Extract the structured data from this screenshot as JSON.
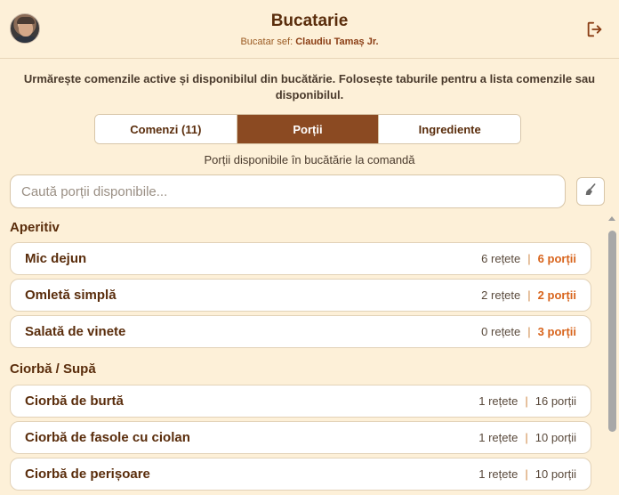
{
  "header": {
    "title": "Bucatarie",
    "chef_prefix": "Bucatar sef:",
    "chef_name": "Claudiu Tamaș Jr.",
    "avatar_icon": "user-avatar",
    "logout_icon": "logout-icon"
  },
  "description": "Urmărește comenzile active și disponibilul din bucătărie. Folosește taburile pentru a lista comenzile sau disponibilul.",
  "tabs": [
    {
      "label": "Comenzi (11)",
      "active": false
    },
    {
      "label": "Porții",
      "active": true
    },
    {
      "label": "Ingrediente",
      "active": false
    }
  ],
  "tab_caption": "Porții disponibile în bucătărie la comandă",
  "search": {
    "placeholder": "Caută porții disponibile...",
    "clear_icon": "broom-icon"
  },
  "colors": {
    "background": "#fdf0d8",
    "accent": "#8b4a22",
    "highlight": "#d8641c",
    "text": "#5a2d0c"
  },
  "groups": [
    {
      "title": "Aperitiv",
      "items": [
        {
          "name": "Mic dejun",
          "recipes": "6 rețete",
          "portions": "6 porții",
          "highlight": true
        },
        {
          "name": "Omletă simplă",
          "recipes": "2 rețete",
          "portions": "2 porții",
          "highlight": true
        },
        {
          "name": "Salată de vinete",
          "recipes": "0 rețete",
          "portions": "3 porții",
          "highlight": true
        }
      ]
    },
    {
      "title": "Ciorbă / Supă",
      "items": [
        {
          "name": "Ciorbă de burtă",
          "recipes": "1 rețete",
          "portions": "16 porții",
          "highlight": false
        },
        {
          "name": "Ciorbă de fasole cu ciolan",
          "recipes": "1 rețete",
          "portions": "10 porții",
          "highlight": false
        },
        {
          "name": "Ciorbă de perișoare",
          "recipes": "1 rețete",
          "portions": "10 porții",
          "highlight": false
        }
      ]
    }
  ]
}
